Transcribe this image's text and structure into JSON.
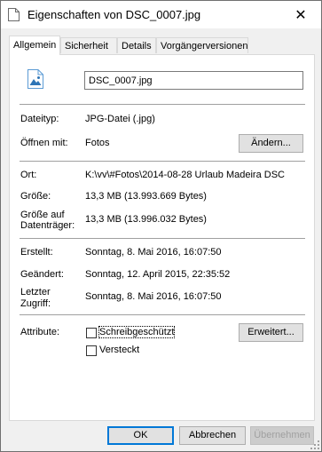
{
  "window": {
    "title": "Eigenschaften von DSC_0007.jpg"
  },
  "tabs": [
    {
      "label": "Allgemein"
    },
    {
      "label": "Sicherheit"
    },
    {
      "label": "Details"
    },
    {
      "label": "Vorgängerversionen"
    }
  ],
  "general": {
    "filename": "DSC_0007.jpg",
    "filetype_label": "Dateityp:",
    "filetype_value": "JPG-Datei (.jpg)",
    "opens_with_label": "Öffnen mit:",
    "opens_with_value": "Fotos",
    "change_button": "Ändern...",
    "location_label": "Ort:",
    "location_value": "K:\\vv\\#Fotos\\2014-08-28 Urlaub Madeira DSC",
    "size_label": "Größe:",
    "size_value": "13,3 MB (13.993.669 Bytes)",
    "size_on_disk_label_1": "Größe auf",
    "size_on_disk_label_2": "Datenträger:",
    "size_on_disk_value": "13,3 MB (13.996.032 Bytes)",
    "created_label": "Erstellt:",
    "created_value": "Sonntag, 8. Mai 2016, 16:07:50",
    "modified_label": "Geändert:",
    "modified_value": "Sonntag, 12. April 2015, 22:35:52",
    "accessed_label_1": "Letzter",
    "accessed_label_2": "Zugriff:",
    "accessed_value": "Sonntag, 8. Mai 2016, 16:07:50",
    "attributes_label": "Attribute:",
    "readonly_label": "Schreibgeschützt",
    "readonly_checked": false,
    "hidden_label": "Versteckt",
    "hidden_checked": false,
    "advanced_button": "Erweitert..."
  },
  "footer": {
    "ok": "OK",
    "cancel": "Abbrechen",
    "apply": "Übernehmen"
  }
}
